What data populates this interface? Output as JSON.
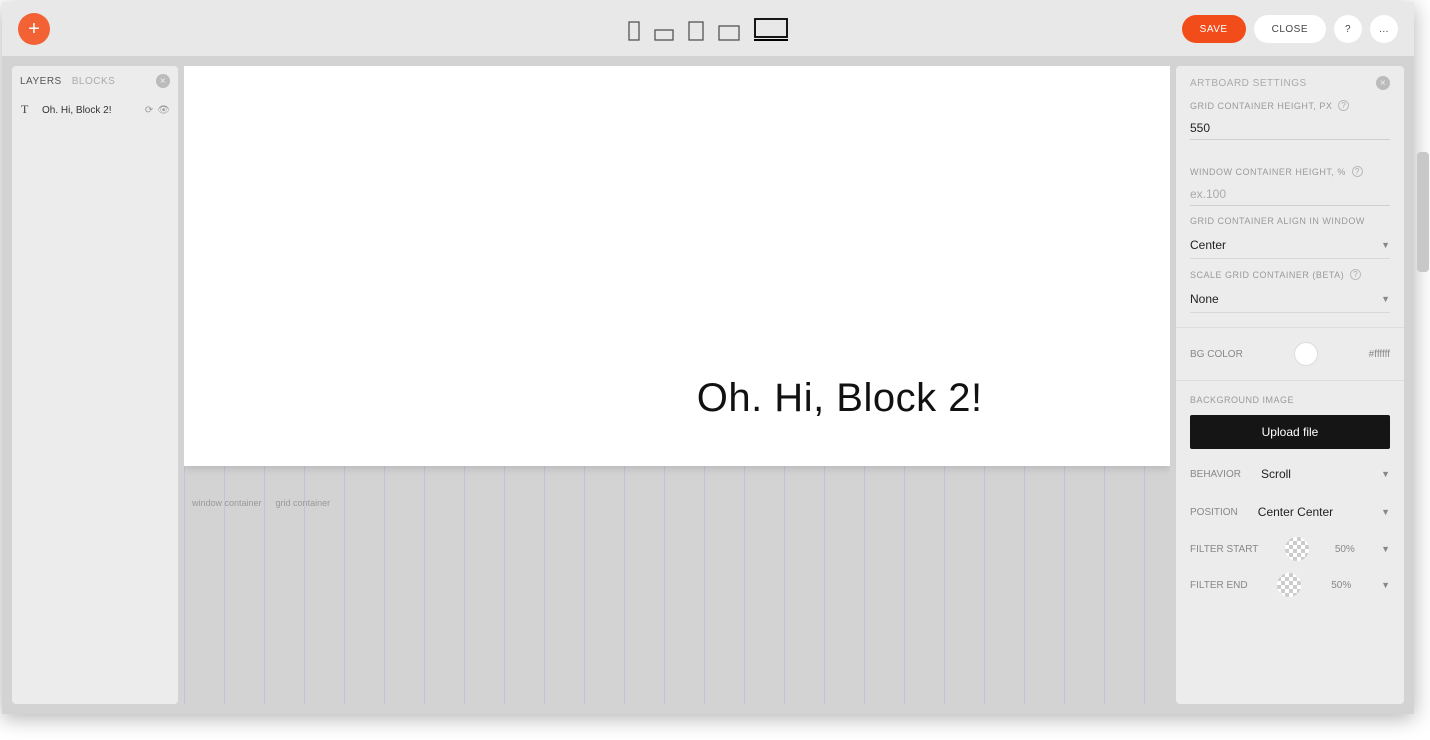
{
  "toolbar": {
    "save": "SAVE",
    "close": "CLOSE",
    "help": "?",
    "more": "..."
  },
  "left": {
    "tab_layers": "LAYERS",
    "tab_blocks": "BLOCKS",
    "layer": {
      "label": "Oh. Hi, Block 2!"
    }
  },
  "canvas": {
    "heading": "Oh. Hi, Block 2!",
    "window_label": "window container",
    "grid_label": "grid container"
  },
  "right": {
    "title": "ARTBOARD SETTINGS",
    "grid_height_label": "GRID CONTAINER HEIGHT, PX",
    "grid_height_value": "550",
    "window_height_label": "WINDOW CONTAINER HEIGHT, %",
    "window_height_placeholder": "ex.100",
    "align_label": "GRID CONTAINER ALIGN IN WINDOW",
    "align_value": "Center",
    "scale_label": "SCALE GRID CONTAINER (BETA)",
    "scale_value": "None",
    "bgcolor_label": "BG COLOR",
    "bgcolor_value": "#ffffff",
    "bgimage_label": "BACKGROUND IMAGE",
    "upload": "Upload file",
    "behavior_label": "BEHAVIOR",
    "behavior_value": "Scroll",
    "position_label": "POSITION",
    "position_value": "Center Center",
    "filter_start_label": "FILTER START",
    "filter_start_value": "50%",
    "filter_end_label": "FILTER END",
    "filter_end_value": "50%"
  }
}
